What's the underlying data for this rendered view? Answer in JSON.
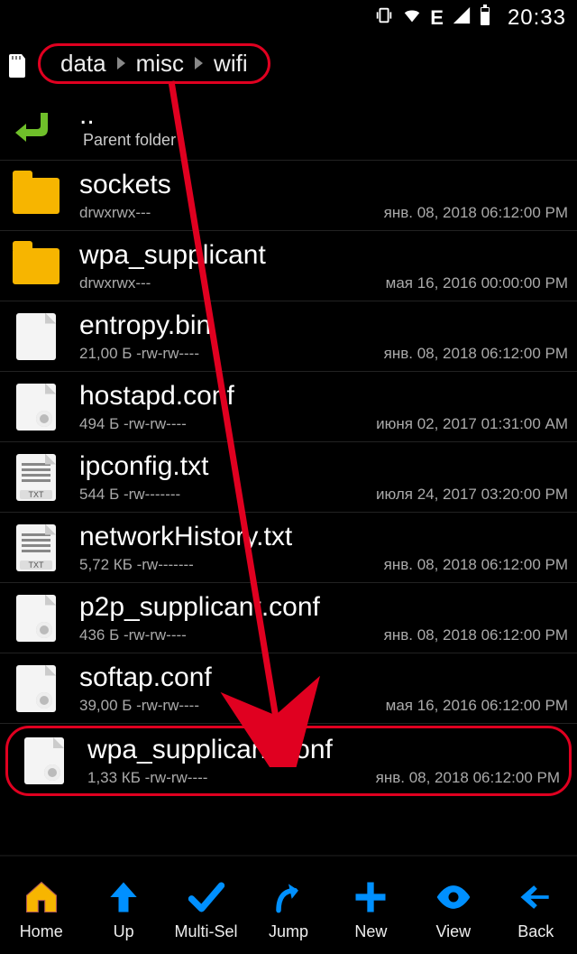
{
  "status": {
    "time": "20:33",
    "network_label": "E"
  },
  "breadcrumb": [
    "data",
    "misc",
    "wifi"
  ],
  "parent": {
    "dots": "..",
    "label": "Parent folder"
  },
  "items": [
    {
      "name": "sockets",
      "perm": "drwxrwx---",
      "date": "янв. 08, 2018 06:12:00 PM",
      "kind": "folder"
    },
    {
      "name": "wpa_supplicant",
      "perm": "drwxrwx---",
      "date": "мая 16, 2016 00:00:00 PM",
      "kind": "folder"
    },
    {
      "name": "entropy.bin",
      "perm": "21,00 Б -rw-rw----",
      "date": "янв. 08, 2018 06:12:00 PM",
      "kind": "file"
    },
    {
      "name": "hostapd.conf",
      "perm": "494 Б -rw-rw----",
      "date": "июня 02, 2017 01:31:00 AM",
      "kind": "conf"
    },
    {
      "name": "ipconfig.txt",
      "perm": "544 Б -rw-------",
      "date": "июля 24, 2017 03:20:00 PM",
      "kind": "txt"
    },
    {
      "name": "networkHistory.txt",
      "perm": "5,72 КБ -rw-------",
      "date": "янв. 08, 2018 06:12:00 PM",
      "kind": "txt"
    },
    {
      "name": "p2p_supplicant.conf",
      "perm": "436 Б -rw-rw----",
      "date": "янв. 08, 2018 06:12:00 PM",
      "kind": "conf"
    },
    {
      "name": "softap.conf",
      "perm": "39,00 Б -rw-rw----",
      "date": "мая 16, 2016 06:12:00 PM",
      "kind": "conf"
    },
    {
      "name": "wpa_supplicant.conf",
      "perm": "1,33 КБ -rw-rw----",
      "date": "янв. 08, 2018 06:12:00 PM",
      "kind": "conf",
      "highlight": true
    }
  ],
  "toolbar": [
    {
      "label": "Home",
      "icon": "home"
    },
    {
      "label": "Up",
      "icon": "up"
    },
    {
      "label": "Multi-Sel",
      "icon": "check"
    },
    {
      "label": "Jump",
      "icon": "jump"
    },
    {
      "label": "New",
      "icon": "plus"
    },
    {
      "label": "View",
      "icon": "eye"
    },
    {
      "label": "Back",
      "icon": "back"
    }
  ],
  "txt_badge": "TXT"
}
